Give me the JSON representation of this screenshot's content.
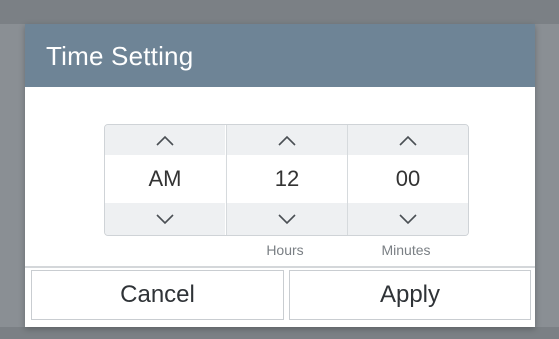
{
  "dialog": {
    "title": "Time Setting",
    "header_color": "#6e8496"
  },
  "picker": {
    "columns": [
      {
        "value": "AM",
        "unit": "",
        "up_icon": "chevron-up-icon",
        "down_icon": "chevron-down-icon"
      },
      {
        "value": "12",
        "unit": "Hours",
        "up_icon": "chevron-up-icon",
        "down_icon": "chevron-down-icon"
      },
      {
        "value": "00",
        "unit": "Minutes",
        "up_icon": "chevron-up-icon",
        "down_icon": "chevron-down-icon"
      }
    ]
  },
  "buttons": {
    "cancel_label": "Cancel",
    "apply_label": "Apply"
  }
}
